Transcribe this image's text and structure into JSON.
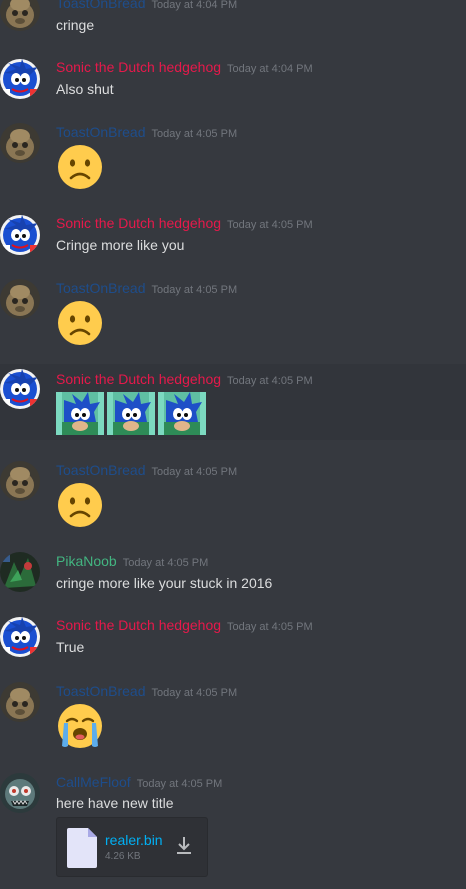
{
  "colors": {
    "toast": "#1e4d8b",
    "sonic": "#e6194b",
    "pika": "#43b581",
    "call": "#1e4d8b"
  },
  "messages": [
    {
      "user": "ToastOnBread",
      "time": "Today at 4:04 PM",
      "text": "cringe"
    },
    {
      "user": "Sonic the Dutch hedgehog",
      "time": "Today at 4:04 PM",
      "text": "Also shut"
    },
    {
      "user": "ToastOnBread",
      "time": "Today at 4:05 PM",
      "emoji": "frowning-face"
    },
    {
      "user": "Sonic the Dutch hedgehog",
      "time": "Today at 4:05 PM",
      "text": "Cringe more like you"
    },
    {
      "user": "ToastOnBread",
      "time": "Today at 4:05 PM",
      "emoji": "frowning-face"
    },
    {
      "user": "Sonic the Dutch hedgehog",
      "time": "Today at 4:05 PM",
      "images": [
        "sonic-image",
        "sonic-image",
        "sonic-image"
      ]
    },
    {
      "user": "ToastOnBread",
      "time": "Today at 4:05 PM",
      "emoji": "frowning-face"
    },
    {
      "user": "PikaNoob",
      "time": "Today at 4:05 PM",
      "text": "cringe more like your stuck in 2016"
    },
    {
      "user": "Sonic the Dutch hedgehog",
      "time": "Today at 4:05 PM",
      "text": "True"
    },
    {
      "user": "ToastOnBread",
      "time": "Today at 4:05 PM",
      "emoji": "loudly-crying-face"
    },
    {
      "user": "CallMeFloof",
      "time": "Today at 4:05 PM",
      "text": "here have new title"
    }
  ],
  "attachment": {
    "file_name": "realer.bin",
    "file_size": "4.26 KB",
    "icon": "file-icon",
    "action_icon": "download-icon"
  }
}
